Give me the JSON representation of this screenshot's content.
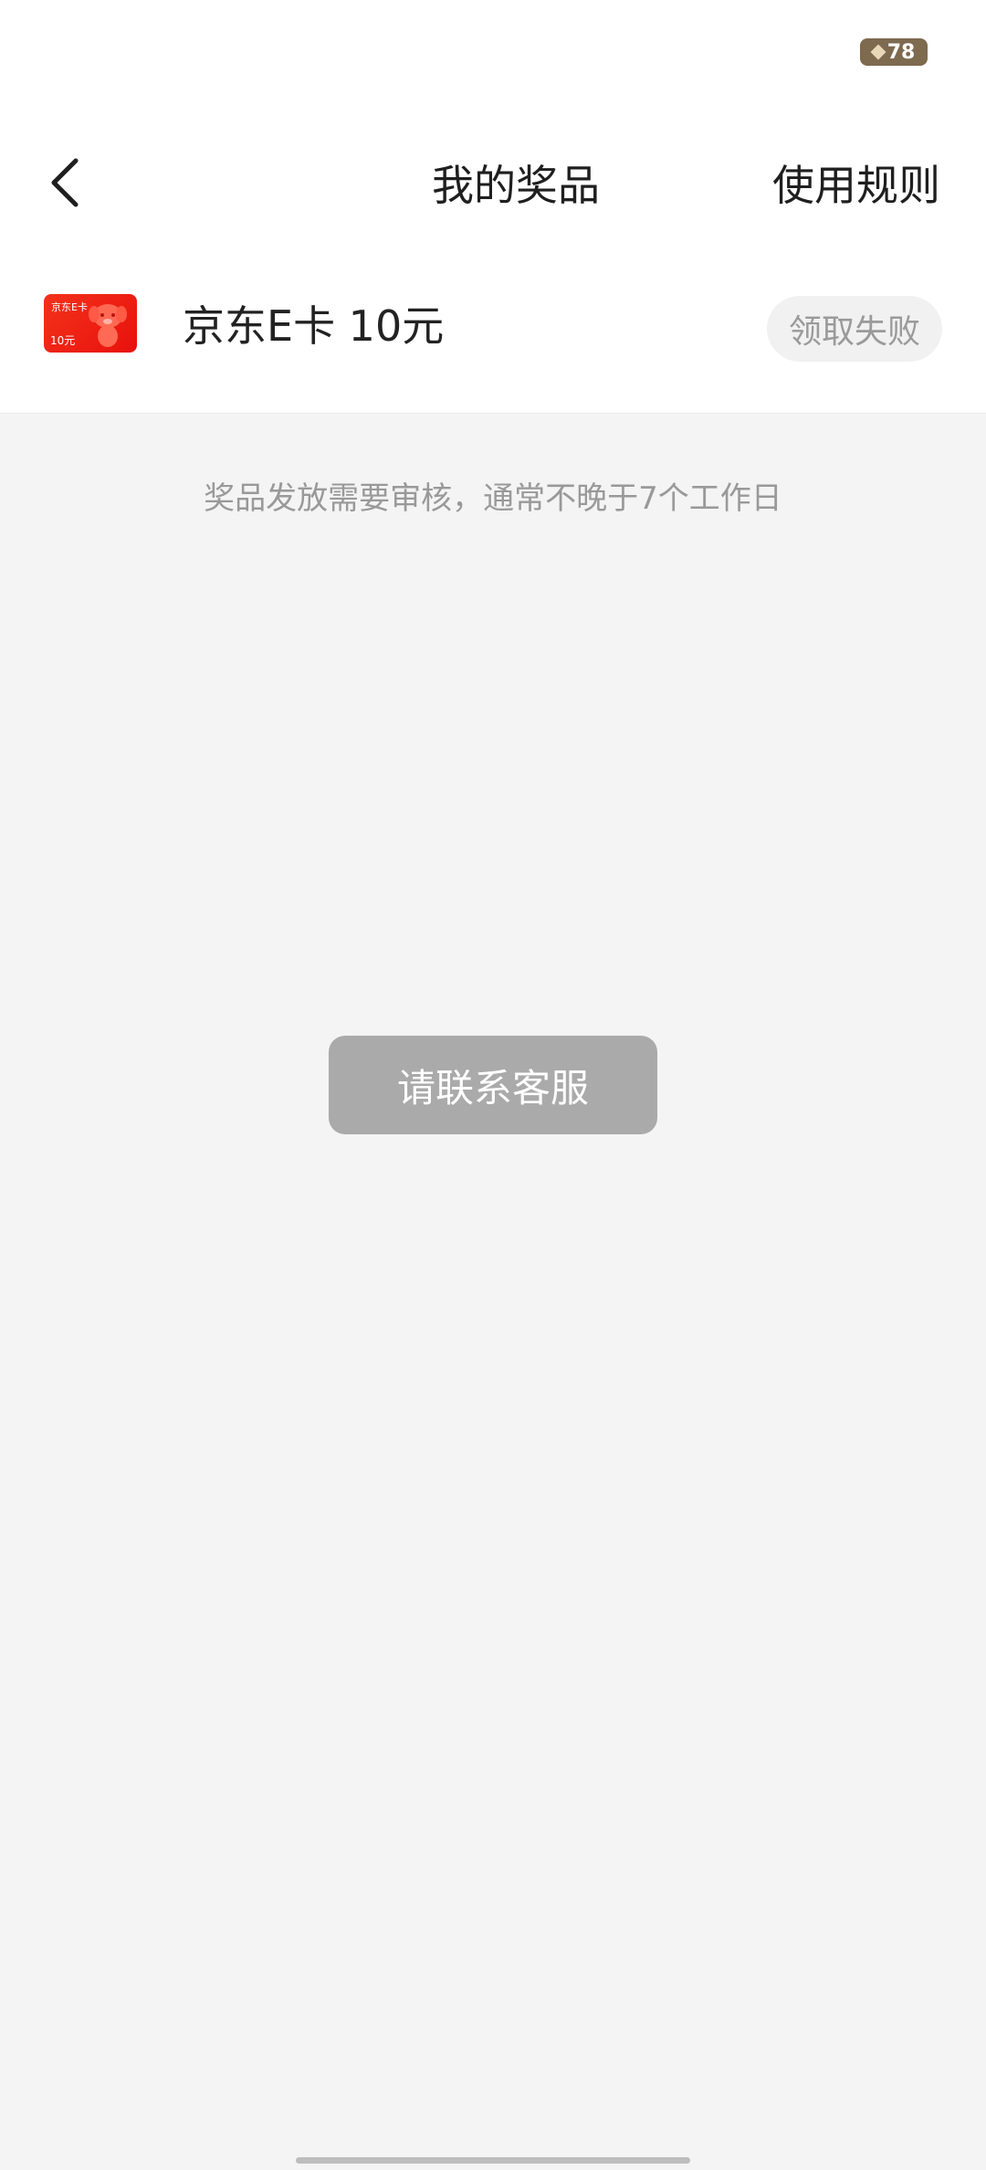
{
  "status_bar": {
    "battery_level": "78"
  },
  "header": {
    "title": "我的奖品",
    "rules_label": "使用规则"
  },
  "prize": {
    "card_brand": "京东E卡",
    "card_amount": "10元",
    "name": "京东E卡 10元",
    "status": "领取失败"
  },
  "notice": "奖品发放需要审核，通常不晚于7个工作日",
  "contact_button": "请联系客服",
  "colors": {
    "card_red": "#e8110c",
    "button_gray": "#aaaaaa",
    "background": "#f4f4f4"
  },
  "icons": {
    "back": "chevron-left-icon",
    "battery": "battery-icon"
  }
}
